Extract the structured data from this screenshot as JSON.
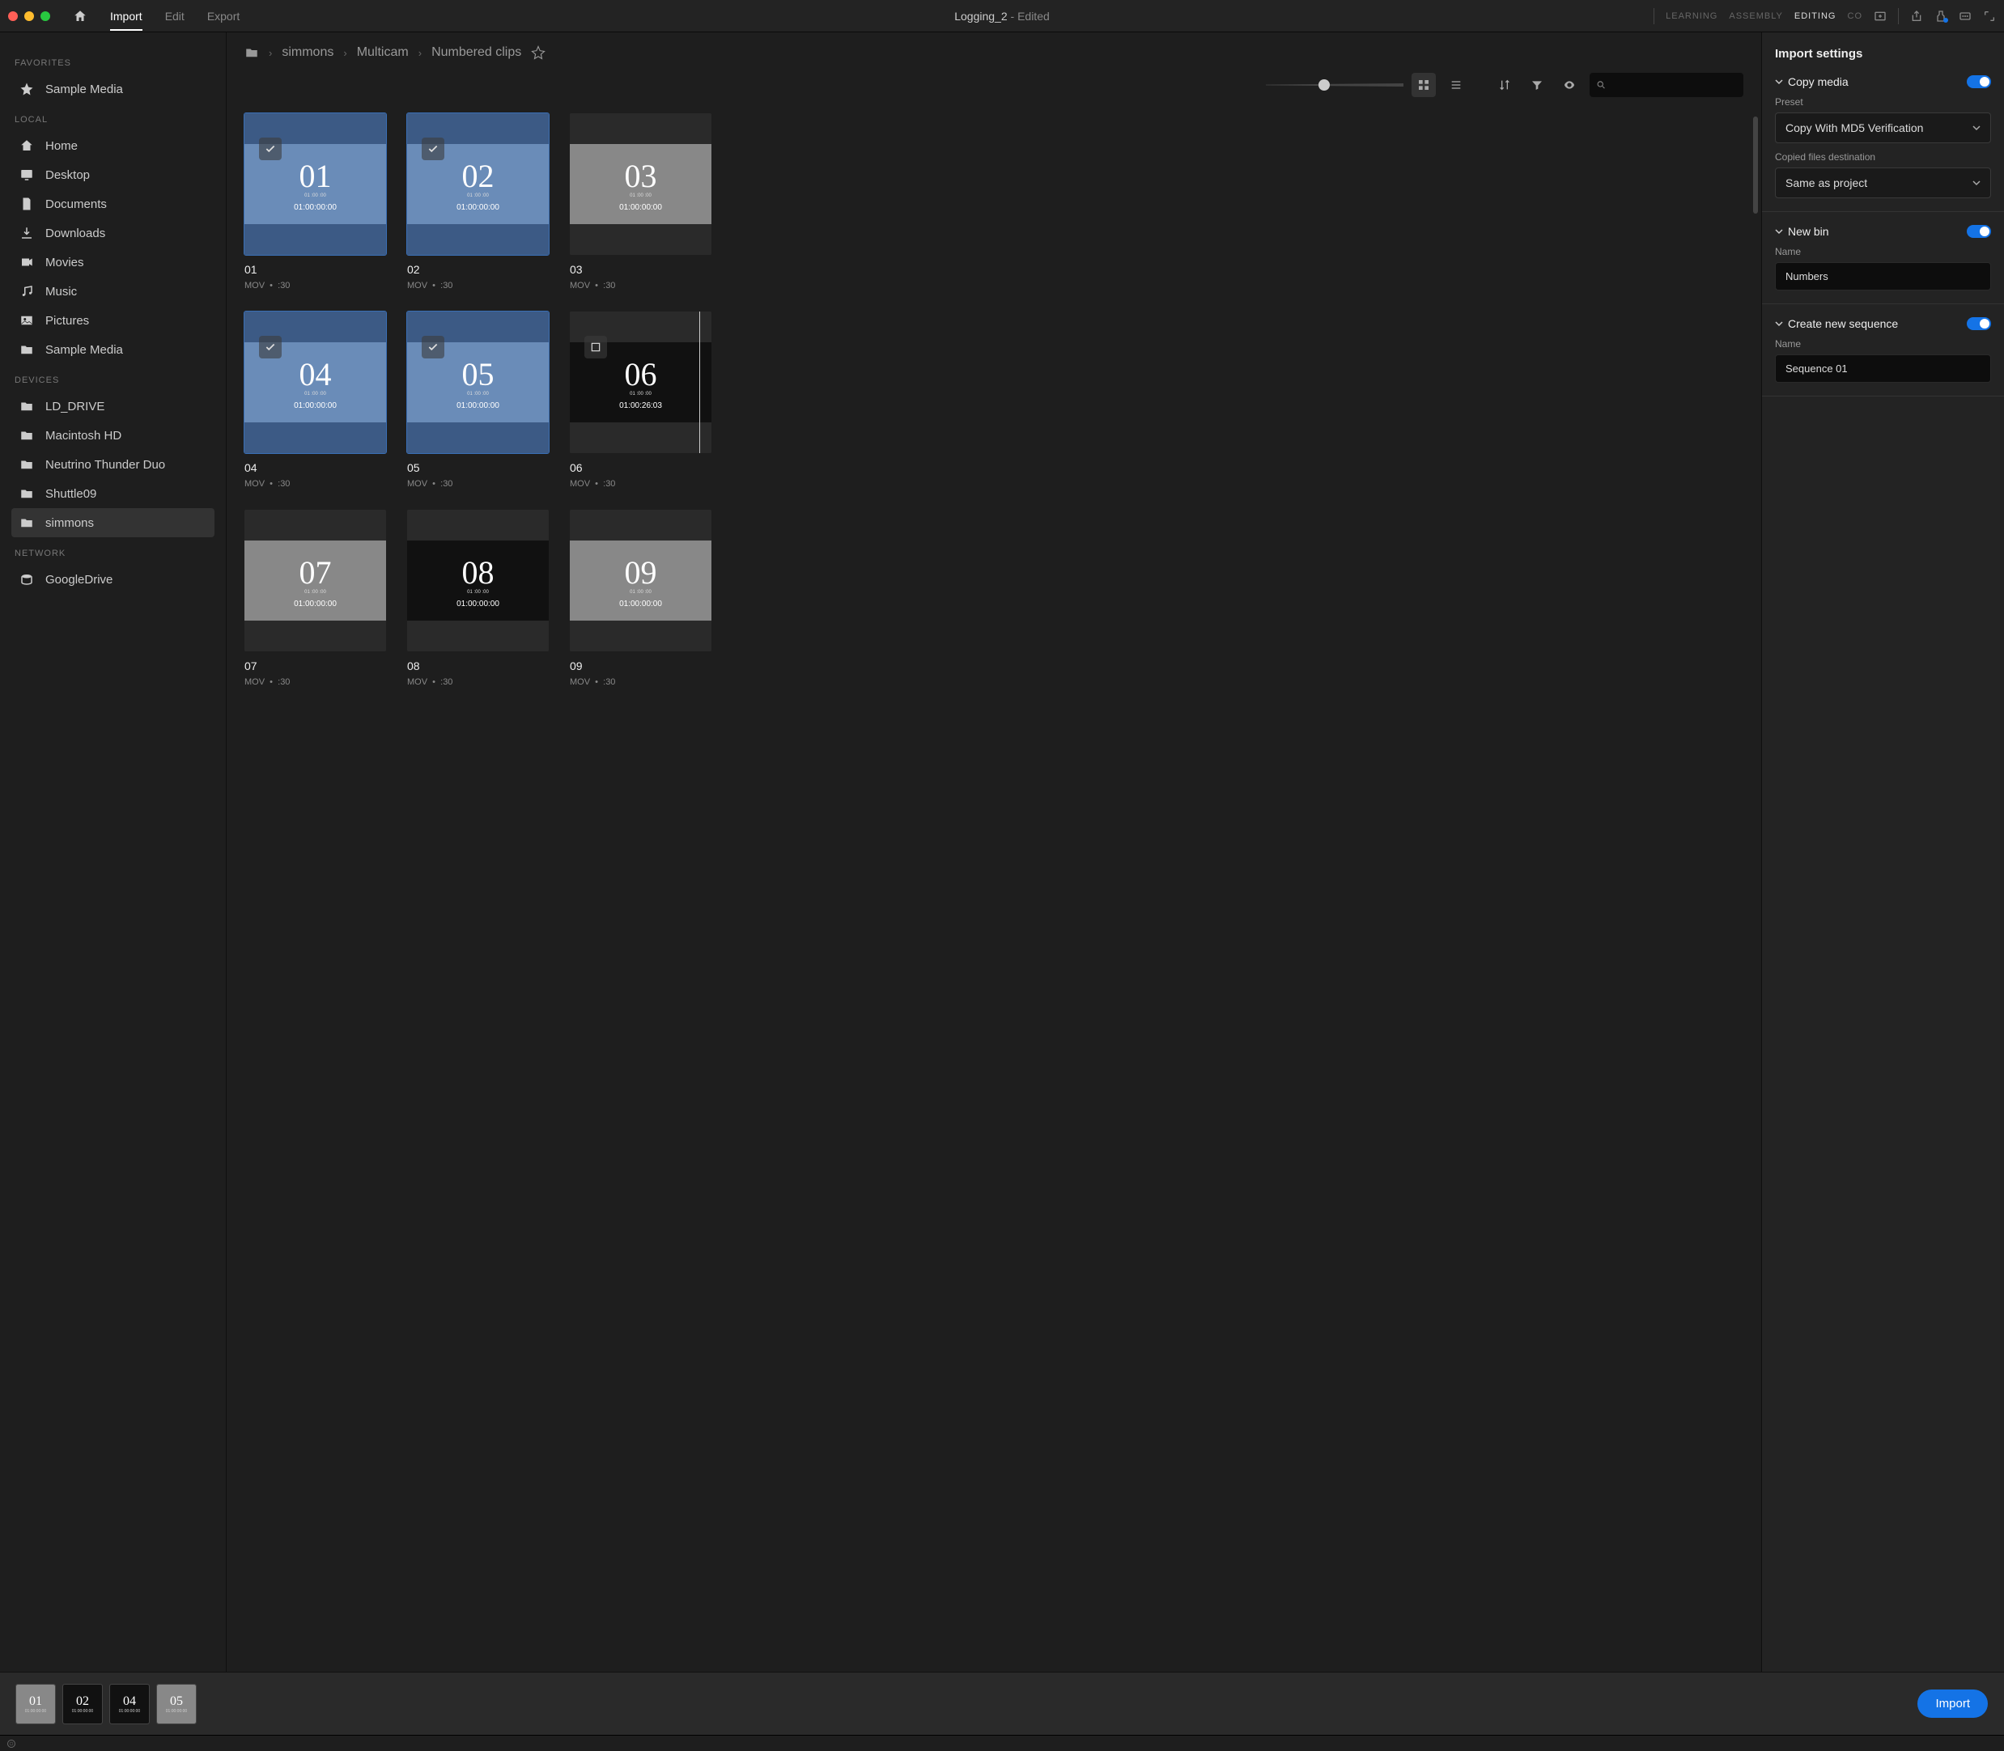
{
  "topbar": {
    "tabs": {
      "import": "Import",
      "edit": "Edit",
      "export": "Export"
    },
    "project_name": "Logging_2",
    "project_suffix": " - Edited",
    "workspace": {
      "learning": "LEARNING",
      "assembly": "ASSEMBLY",
      "editing": "EDITING",
      "color": "CO"
    }
  },
  "sidebar": {
    "sections": {
      "favorites": {
        "label": "FAVORITES",
        "items": [
          "Sample Media"
        ]
      },
      "local": {
        "label": "LOCAL",
        "items": [
          "Home",
          "Desktop",
          "Documents",
          "Downloads",
          "Movies",
          "Music",
          "Pictures",
          "Sample Media"
        ]
      },
      "devices": {
        "label": "DEVICES",
        "items": [
          "LD_DRIVE",
          "Macintosh HD",
          "Neutrino Thunder Duo",
          "Shuttle09",
          "simmons"
        ]
      },
      "network": {
        "label": "NETWORK",
        "items": [
          "GoogleDrive"
        ]
      }
    }
  },
  "breadcrumbs": [
    "simmons",
    "Multicam",
    "Numbered clips"
  ],
  "search": {
    "placeholder": ""
  },
  "clips": [
    {
      "big": "01",
      "name": "01",
      "tc": "01:00:00:00",
      "fmt": "MOV",
      "dur": ":30",
      "selected": true,
      "checked": true,
      "dark": false
    },
    {
      "big": "02",
      "name": "02",
      "tc": "01:00:00:00",
      "fmt": "MOV",
      "dur": ":30",
      "selected": true,
      "checked": true,
      "dark": false
    },
    {
      "big": "03",
      "name": "03",
      "tc": "01:00:00:00",
      "fmt": "MOV",
      "dur": ":30",
      "selected": false,
      "checked": false,
      "dark": false,
      "nocb": true
    },
    {
      "big": "04",
      "name": "04",
      "tc": "01:00:00:00",
      "fmt": "MOV",
      "dur": ":30",
      "selected": true,
      "checked": true,
      "dark": false
    },
    {
      "big": "05",
      "name": "05",
      "tc": "01:00:00:00",
      "fmt": "MOV",
      "dur": ":30",
      "selected": true,
      "checked": true,
      "dark": false
    },
    {
      "big": "06",
      "name": "06",
      "tc": "01:00:26:03",
      "fmt": "MOV",
      "dur": ":30",
      "selected": false,
      "checked": false,
      "dark": true,
      "playhead": true,
      "sub": "01:00:26:03"
    },
    {
      "big": "07",
      "name": "07",
      "tc": "01:00:00:00",
      "fmt": "MOV",
      "dur": ":30",
      "selected": false,
      "checked": false,
      "dark": false,
      "nocb": true
    },
    {
      "big": "08",
      "name": "08",
      "tc": "01:00:00:00",
      "fmt": "MOV",
      "dur": ":30",
      "selected": false,
      "checked": false,
      "dark": true,
      "nocb": true
    },
    {
      "big": "09",
      "name": "09",
      "tc": "01:00:00:00",
      "fmt": "MOV",
      "dur": ":30",
      "selected": false,
      "checked": false,
      "dark": false,
      "nocb": true
    }
  ],
  "tray": [
    {
      "n": "01",
      "tc": "01:00:00:00",
      "dark": false
    },
    {
      "n": "02",
      "tc": "01:00:00:00",
      "dark": true
    },
    {
      "n": "04",
      "tc": "01:00:00:00",
      "dark": true
    },
    {
      "n": "05",
      "tc": "01:00:00:00",
      "dark": false
    }
  ],
  "import_button": "Import",
  "settings": {
    "title": "Import settings",
    "copy_media": {
      "label": "Copy media",
      "preset_label": "Preset",
      "preset_value": "Copy With MD5 Verification",
      "dest_label": "Copied files destination",
      "dest_value": "Same as project"
    },
    "new_bin": {
      "label": "New bin",
      "name_label": "Name",
      "name_value": "Numbers"
    },
    "new_seq": {
      "label": "Create new sequence",
      "name_label": "Name",
      "name_value": "Sequence 01"
    }
  }
}
